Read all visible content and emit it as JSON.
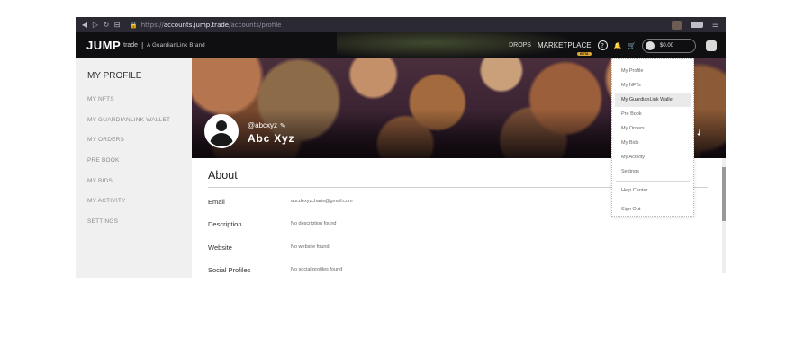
{
  "browser": {
    "nav_icons": [
      "◀",
      "▷",
      "↻",
      "⊟"
    ],
    "url_prefix": "https://",
    "url_host": "accounts.jump.trade",
    "url_path": "/accounts/profile",
    "menu_icon": "☰"
  },
  "header": {
    "logo": "JUMP",
    "logo_suffix": "trade",
    "separator": "|",
    "brand": "A GuardianLink Brand",
    "drops": "DROPS",
    "marketplace": "MARKETPLACE",
    "beta_badge": "BETA",
    "help_icon": "?",
    "bell_icon": "🔔",
    "cart_icon": "🛒",
    "wallet_balance": "$0.00"
  },
  "sidebar": {
    "title": "MY PROFILE",
    "items": [
      {
        "label": "MY NFTS"
      },
      {
        "label": "MY GUARDIANLINK WALLET"
      },
      {
        "label": "MY ORDERS"
      },
      {
        "label": "PRE BOOK"
      },
      {
        "label": "MY BIDS"
      },
      {
        "label": "MY ACTIVITY"
      },
      {
        "label": "SETTINGS"
      }
    ]
  },
  "profile": {
    "handle": "@abcxyz",
    "edit_icon": "✎",
    "name": "Abc Xyz",
    "chevron": "✓"
  },
  "about": {
    "title": "About",
    "rows": [
      {
        "label": "Email",
        "value": "abcdexyzcharis@gmail.com"
      },
      {
        "label": "Description",
        "value": "No description found"
      },
      {
        "label": "Website",
        "value": "No website found"
      },
      {
        "label": "Social Profiles",
        "value": "No social profiles found"
      }
    ]
  },
  "dropdown": {
    "items": [
      {
        "label": "My Profile"
      },
      {
        "label": "My NFTs"
      },
      {
        "label": "My GuardianLink Wallet"
      },
      {
        "label": "Pre Book"
      },
      {
        "label": "My Orders"
      },
      {
        "label": "My Bids"
      },
      {
        "label": "My Activity"
      },
      {
        "label": "Settings"
      }
    ],
    "help_center": "Help Center",
    "sign_out": "Sign Out"
  }
}
